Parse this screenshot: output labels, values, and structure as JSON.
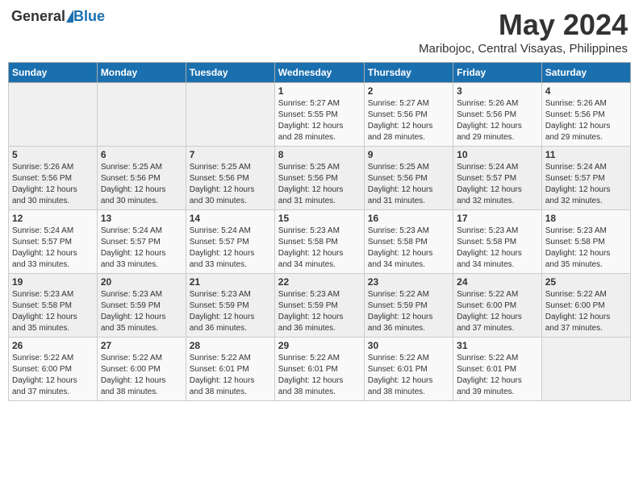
{
  "header": {
    "logo_general": "General",
    "logo_blue": "Blue",
    "month_title": "May 2024",
    "location": "Maribojoc, Central Visayas, Philippines"
  },
  "days_of_week": [
    "Sunday",
    "Monday",
    "Tuesday",
    "Wednesday",
    "Thursday",
    "Friday",
    "Saturday"
  ],
  "weeks": [
    [
      {
        "day": "",
        "info": ""
      },
      {
        "day": "",
        "info": ""
      },
      {
        "day": "",
        "info": ""
      },
      {
        "day": "1",
        "info": "Sunrise: 5:27 AM\nSunset: 5:55 PM\nDaylight: 12 hours\nand 28 minutes."
      },
      {
        "day": "2",
        "info": "Sunrise: 5:27 AM\nSunset: 5:56 PM\nDaylight: 12 hours\nand 28 minutes."
      },
      {
        "day": "3",
        "info": "Sunrise: 5:26 AM\nSunset: 5:56 PM\nDaylight: 12 hours\nand 29 minutes."
      },
      {
        "day": "4",
        "info": "Sunrise: 5:26 AM\nSunset: 5:56 PM\nDaylight: 12 hours\nand 29 minutes."
      }
    ],
    [
      {
        "day": "5",
        "info": "Sunrise: 5:26 AM\nSunset: 5:56 PM\nDaylight: 12 hours\nand 30 minutes."
      },
      {
        "day": "6",
        "info": "Sunrise: 5:25 AM\nSunset: 5:56 PM\nDaylight: 12 hours\nand 30 minutes."
      },
      {
        "day": "7",
        "info": "Sunrise: 5:25 AM\nSunset: 5:56 PM\nDaylight: 12 hours\nand 30 minutes."
      },
      {
        "day": "8",
        "info": "Sunrise: 5:25 AM\nSunset: 5:56 PM\nDaylight: 12 hours\nand 31 minutes."
      },
      {
        "day": "9",
        "info": "Sunrise: 5:25 AM\nSunset: 5:56 PM\nDaylight: 12 hours\nand 31 minutes."
      },
      {
        "day": "10",
        "info": "Sunrise: 5:24 AM\nSunset: 5:57 PM\nDaylight: 12 hours\nand 32 minutes."
      },
      {
        "day": "11",
        "info": "Sunrise: 5:24 AM\nSunset: 5:57 PM\nDaylight: 12 hours\nand 32 minutes."
      }
    ],
    [
      {
        "day": "12",
        "info": "Sunrise: 5:24 AM\nSunset: 5:57 PM\nDaylight: 12 hours\nand 33 minutes."
      },
      {
        "day": "13",
        "info": "Sunrise: 5:24 AM\nSunset: 5:57 PM\nDaylight: 12 hours\nand 33 minutes."
      },
      {
        "day": "14",
        "info": "Sunrise: 5:24 AM\nSunset: 5:57 PM\nDaylight: 12 hours\nand 33 minutes."
      },
      {
        "day": "15",
        "info": "Sunrise: 5:23 AM\nSunset: 5:58 PM\nDaylight: 12 hours\nand 34 minutes."
      },
      {
        "day": "16",
        "info": "Sunrise: 5:23 AM\nSunset: 5:58 PM\nDaylight: 12 hours\nand 34 minutes."
      },
      {
        "day": "17",
        "info": "Sunrise: 5:23 AM\nSunset: 5:58 PM\nDaylight: 12 hours\nand 34 minutes."
      },
      {
        "day": "18",
        "info": "Sunrise: 5:23 AM\nSunset: 5:58 PM\nDaylight: 12 hours\nand 35 minutes."
      }
    ],
    [
      {
        "day": "19",
        "info": "Sunrise: 5:23 AM\nSunset: 5:58 PM\nDaylight: 12 hours\nand 35 minutes."
      },
      {
        "day": "20",
        "info": "Sunrise: 5:23 AM\nSunset: 5:59 PM\nDaylight: 12 hours\nand 35 minutes."
      },
      {
        "day": "21",
        "info": "Sunrise: 5:23 AM\nSunset: 5:59 PM\nDaylight: 12 hours\nand 36 minutes."
      },
      {
        "day": "22",
        "info": "Sunrise: 5:23 AM\nSunset: 5:59 PM\nDaylight: 12 hours\nand 36 minutes."
      },
      {
        "day": "23",
        "info": "Sunrise: 5:22 AM\nSunset: 5:59 PM\nDaylight: 12 hours\nand 36 minutes."
      },
      {
        "day": "24",
        "info": "Sunrise: 5:22 AM\nSunset: 6:00 PM\nDaylight: 12 hours\nand 37 minutes."
      },
      {
        "day": "25",
        "info": "Sunrise: 5:22 AM\nSunset: 6:00 PM\nDaylight: 12 hours\nand 37 minutes."
      }
    ],
    [
      {
        "day": "26",
        "info": "Sunrise: 5:22 AM\nSunset: 6:00 PM\nDaylight: 12 hours\nand 37 minutes."
      },
      {
        "day": "27",
        "info": "Sunrise: 5:22 AM\nSunset: 6:00 PM\nDaylight: 12 hours\nand 38 minutes."
      },
      {
        "day": "28",
        "info": "Sunrise: 5:22 AM\nSunset: 6:01 PM\nDaylight: 12 hours\nand 38 minutes."
      },
      {
        "day": "29",
        "info": "Sunrise: 5:22 AM\nSunset: 6:01 PM\nDaylight: 12 hours\nand 38 minutes."
      },
      {
        "day": "30",
        "info": "Sunrise: 5:22 AM\nSunset: 6:01 PM\nDaylight: 12 hours\nand 38 minutes."
      },
      {
        "day": "31",
        "info": "Sunrise: 5:22 AM\nSunset: 6:01 PM\nDaylight: 12 hours\nand 39 minutes."
      },
      {
        "day": "",
        "info": ""
      }
    ]
  ]
}
